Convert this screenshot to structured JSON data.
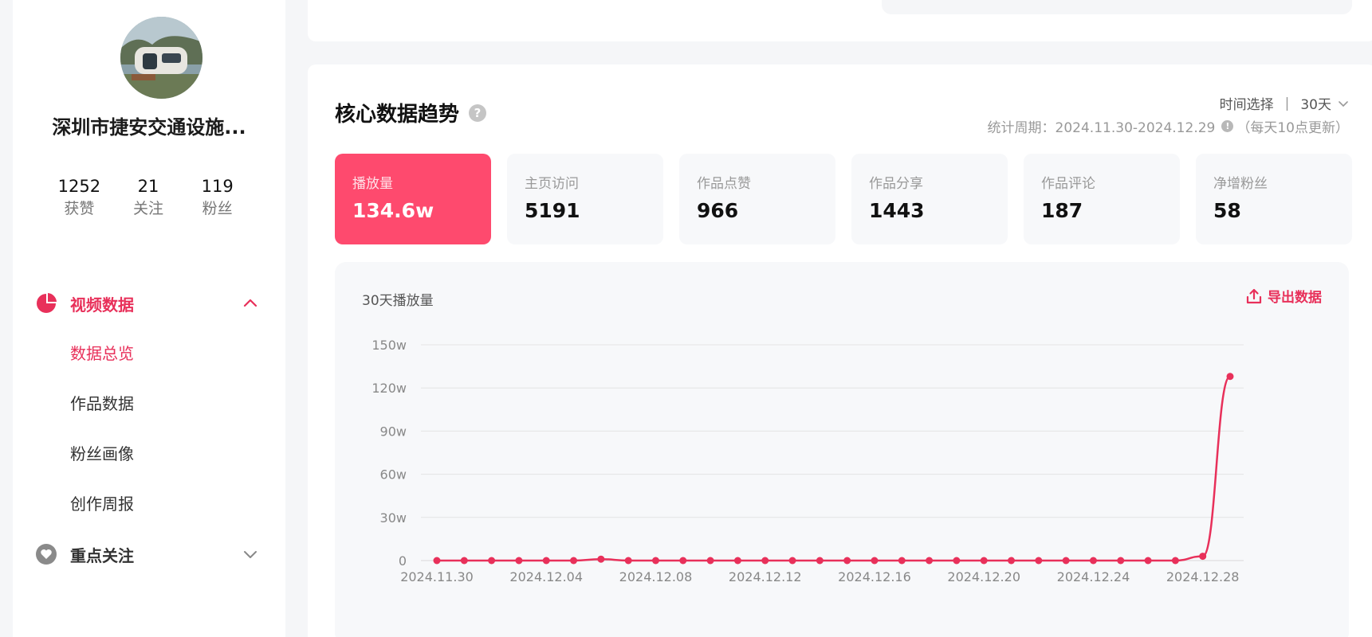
{
  "profile": {
    "name": "深圳市捷安交通设施...",
    "stats": [
      {
        "value": "1252",
        "label": "获赞"
      },
      {
        "value": "21",
        "label": "关注"
      },
      {
        "value": "119",
        "label": "粉丝"
      }
    ]
  },
  "nav": {
    "video_data": {
      "label": "视频数据",
      "items": [
        "数据总览",
        "作品数据",
        "粉丝画像",
        "创作周报"
      ]
    },
    "focus": {
      "label": "重点关注"
    }
  },
  "main": {
    "title": "核心数据趋势",
    "help_icon": "question-icon",
    "time_select_label": "时间选择",
    "time_select_value": "30天",
    "period_text": "统计周期：2024.11.30-2024.12.29",
    "update_note": "（每天10点更新）",
    "metrics": [
      {
        "label": "播放量",
        "value": "134.6w"
      },
      {
        "label": "主页访问",
        "value": "5191"
      },
      {
        "label": "作品点赞",
        "value": "966"
      },
      {
        "label": "作品分享",
        "value": "1443"
      },
      {
        "label": "作品评论",
        "value": "187"
      },
      {
        "label": "净增粉丝",
        "value": "58"
      }
    ],
    "chart_title": "30天播放量",
    "export_label": "导出数据"
  },
  "colors": {
    "accent": "#e8305a",
    "active_card": "#fe4a6e",
    "line": "#e8305a"
  },
  "chart_data": {
    "type": "line",
    "ylim": [
      0,
      150
    ],
    "y_unit": "w",
    "y_ticks": [
      "0",
      "30w",
      "60w",
      "90w",
      "120w",
      "150w"
    ],
    "x_tick_labels": [
      "2024.11.30",
      "2024.12.04",
      "2024.12.08",
      "2024.12.12",
      "2024.12.16",
      "2024.12.20",
      "2024.12.24",
      "2024.12.28"
    ],
    "x": [
      "2024.11.30",
      "2024.12.01",
      "2024.12.02",
      "2024.12.03",
      "2024.12.04",
      "2024.12.05",
      "2024.12.06",
      "2024.12.07",
      "2024.12.08",
      "2024.12.09",
      "2024.12.10",
      "2024.12.11",
      "2024.12.12",
      "2024.12.13",
      "2024.12.14",
      "2024.12.15",
      "2024.12.16",
      "2024.12.17",
      "2024.12.18",
      "2024.12.19",
      "2024.12.20",
      "2024.12.21",
      "2024.12.22",
      "2024.12.23",
      "2024.12.24",
      "2024.12.25",
      "2024.12.26",
      "2024.12.27",
      "2024.12.28",
      "2024.12.29"
    ],
    "series": [
      {
        "values": [
          0,
          0,
          0,
          0,
          0,
          0,
          1,
          0,
          0,
          0,
          0,
          0,
          0,
          0,
          0,
          0,
          0,
          0,
          0,
          0,
          0,
          0,
          0,
          0,
          0,
          0,
          0,
          0,
          3,
          128
        ]
      }
    ],
    "grid": true
  }
}
